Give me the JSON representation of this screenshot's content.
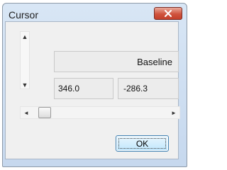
{
  "window": {
    "title": "Cursor"
  },
  "fields": {
    "baseline": "Baseline",
    "x_value": "346.0",
    "y_value": "-286.3"
  },
  "icons": {
    "up": "scroll-up-icon",
    "down": "scroll-down-icon",
    "left": "scroll-left-icon",
    "right": "scroll-right-icon",
    "close": "close-icon"
  },
  "horizontal_scroll": {
    "position_fraction": 0.05
  },
  "buttons": {
    "ok": "OK"
  },
  "colors": {
    "close_button": "#d0543e",
    "ok_button_border": "#3c7fb1",
    "client_background": "#f0f0f0"
  }
}
